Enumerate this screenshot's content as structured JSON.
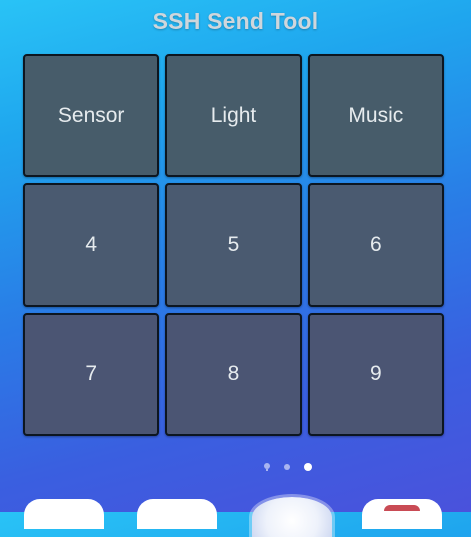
{
  "app": {
    "title": "SSH Send Tool"
  },
  "buttons": [
    {
      "label": "Sensor"
    },
    {
      "label": "Light"
    },
    {
      "label": "Music"
    },
    {
      "label": "4"
    },
    {
      "label": "5"
    },
    {
      "label": "6"
    },
    {
      "label": "7"
    },
    {
      "label": "8"
    },
    {
      "label": "9"
    }
  ],
  "page_indicator": {
    "pages": 3,
    "active_page": 3
  },
  "colors": {
    "background_top": "#29c3f6",
    "background_bottom": "#4a52dc",
    "button_border": "#0d1620",
    "button_text": "#e6ebee"
  }
}
